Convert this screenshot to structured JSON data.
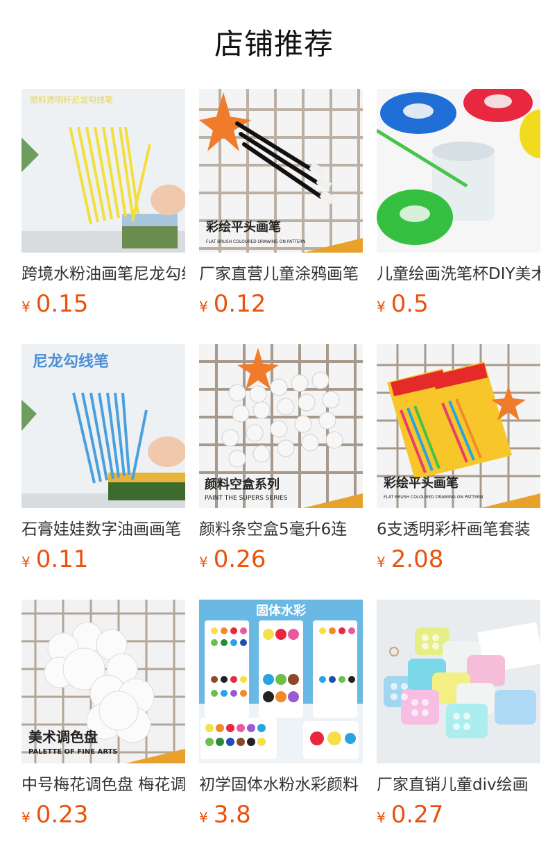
{
  "section": {
    "title": "店铺推荐"
  },
  "products": [
    {
      "name": "跨境水粉油画笔尼龙勾线笔",
      "currency": "¥",
      "price": "0.15",
      "image_caption": "塑料透明杆尼龙勾线笔",
      "image_icon": "paintbrush-set-image"
    },
    {
      "name": "厂家直营儿童涂鸦画笔",
      "currency": "¥",
      "price": "0.12",
      "image_caption": "彩绘平头画笔",
      "image_subcaption": "FLAT BRUSH COLOURED DRAWING ON PATTERN",
      "image_icon": "flat-brush-image"
    },
    {
      "name": "儿童绘画洗笔杯DIY美术",
      "currency": "¥",
      "price": "0.5",
      "image_icon": "wash-cup-image"
    },
    {
      "name": "石膏娃娃数字油画画笔",
      "currency": "¥",
      "price": "0.11",
      "image_caption": "尼龙勾线笔",
      "image_icon": "nylon-brush-image"
    },
    {
      "name": "颜料条空盒5毫升6连",
      "currency": "¥",
      "price": "0.26",
      "image_caption": "颜料空盒系列",
      "image_subcaption": "PAINT THE SUPERS SERIES",
      "image_icon": "paint-pot-image"
    },
    {
      "name": "6支透明彩杆画笔套装",
      "currency": "¥",
      "price": "2.08",
      "image_caption": "彩绘平头画笔",
      "image_subcaption": "FLAT BRUSH COLOURED DRAWING ON PATTERN",
      "image_icon": "brush-pack-image"
    },
    {
      "name": "中号梅花调色盘 梅花调色",
      "currency": "¥",
      "price": "0.23",
      "image_caption": "美术调色盘",
      "image_subcaption": "PALETTE OF FINE ARTS",
      "image_icon": "palette-image"
    },
    {
      "name": "初学固体水粉水彩颜料",
      "currency": "¥",
      "price": "3.8",
      "image_caption": "固体水彩",
      "image_subcaption": "固体水彩",
      "image_icon": "watercolor-set-image"
    },
    {
      "name": "厂家直销儿童div绘画",
      "currency": "¥",
      "price": "0.27",
      "image_icon": "mini-palette-image"
    }
  ],
  "colors": {
    "price": "#e8520c",
    "title": "#111111",
    "text": "#333333"
  }
}
